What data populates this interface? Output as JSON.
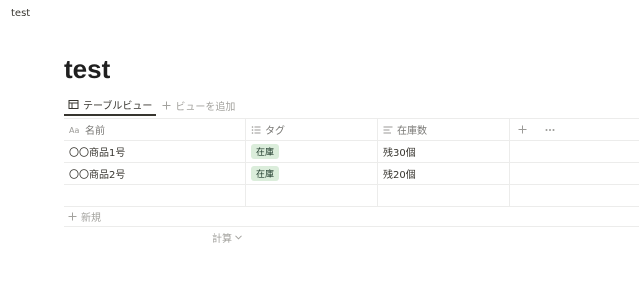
{
  "topbar": {
    "title": "test"
  },
  "page": {
    "title": "test"
  },
  "views": {
    "active_tab_label": "テーブルビュー",
    "add_view_label": "ビューを追加"
  },
  "table": {
    "columns": [
      {
        "label": "名前",
        "icon": "title-aa-icon"
      },
      {
        "label": "タグ",
        "icon": "list-icon"
      },
      {
        "label": "在庫数",
        "icon": "text-lines-icon"
      }
    ],
    "rows": [
      {
        "name": "〇〇商品1号",
        "tag": "在庫",
        "stock": "残30個"
      },
      {
        "name": "〇〇商品2号",
        "tag": "在庫",
        "stock": "残20個"
      }
    ],
    "new_label": "新規",
    "calc_label": "計算"
  },
  "colors": {
    "tag_background": "#dbeddb",
    "tag_text": "#1c3829",
    "muted_text": "#a3a29e"
  }
}
